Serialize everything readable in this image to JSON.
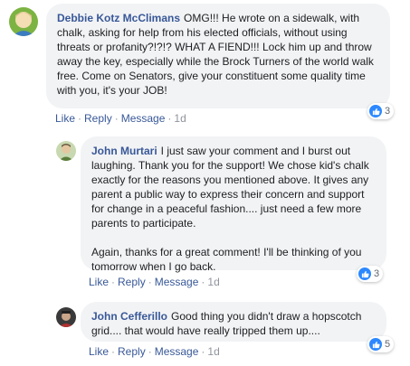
{
  "comments": [
    {
      "author": "Debbie Kotz McClimans",
      "text": "OMG!!! He wrote on a sidewalk, with chalk, asking for help from his elected officials, without using threats or profanity?!?!? WHAT A FIEND!!! Lock him up and throw away the key, especially while the Brock Turners of the world walk free. Come on Senators, give your constituent some quality time with you, it's your JOB!",
      "reaction_count": "3",
      "actions": {
        "like": "Like",
        "reply": "Reply",
        "message": "Message",
        "time": "1d"
      }
    },
    {
      "author": "John Murtari",
      "text": "I just saw your comment and I burst out laughing. Thank you for the support! We chose kid's chalk exactly for the reasons you mentioned above. It gives any parent a public way to express their concern and support for change in a peaceful fashion.... just need a few more parents to participate.",
      "text2": "Again, thanks for a great comment! I'll be thinking of you tomorrow when I go back.",
      "reaction_count": "3",
      "actions": {
        "like": "Like",
        "reply": "Reply",
        "message": "Message",
        "time": "1d"
      }
    },
    {
      "author": "John Cefferillo",
      "text": "Good thing you didn't draw a hopscotch grid.... that would have really tripped them up....",
      "reaction_count": "5",
      "actions": {
        "like": "Like",
        "reply": "Reply",
        "message": "Message",
        "time": "1d"
      }
    }
  ],
  "separator": "·",
  "colors": {
    "link": "#385898",
    "bubble": "#f2f3f5",
    "like": "#2d88ff",
    "muted": "#90949c"
  }
}
